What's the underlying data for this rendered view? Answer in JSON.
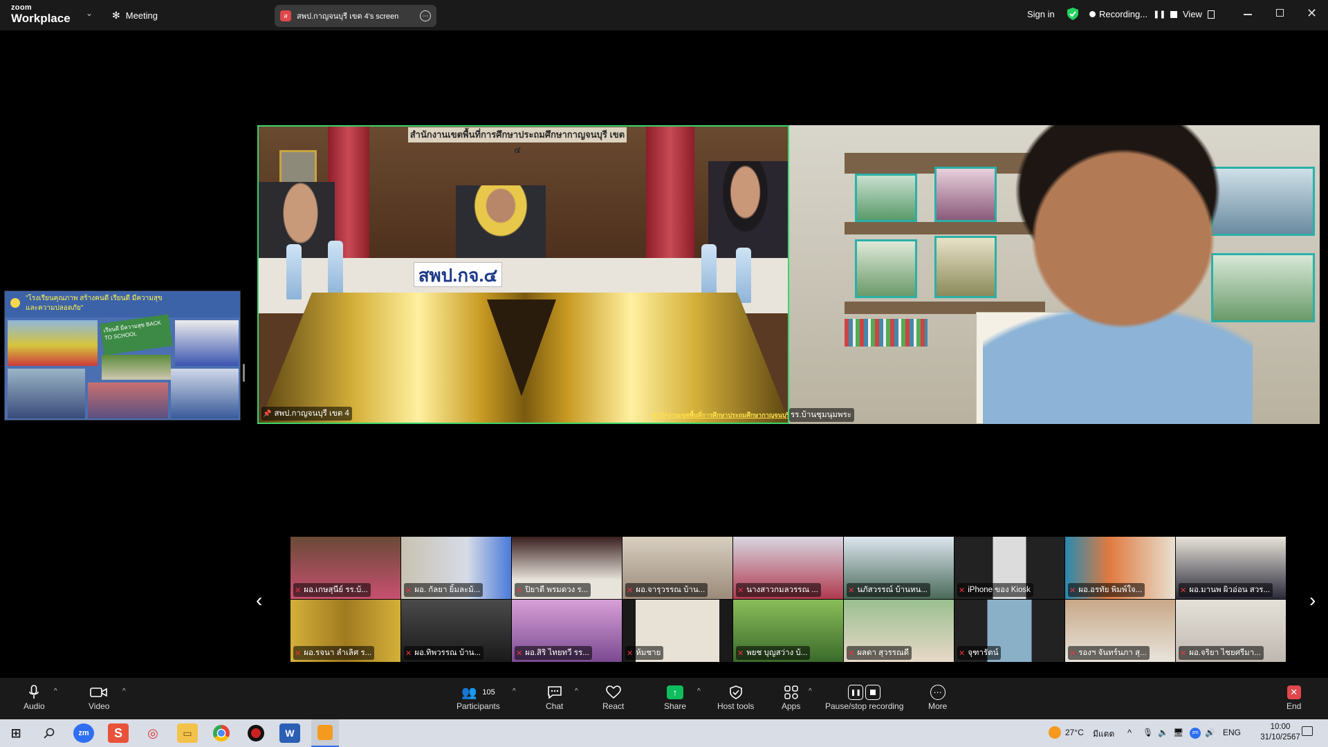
{
  "app": {
    "brand_small": "zoom",
    "brand_large": "Workplace",
    "menu_chevron": "⌄"
  },
  "topbar": {
    "meeting_label": "Meeting",
    "share_tab_label": "สพป.กาญจนบุรี เขต 4's screen",
    "sign_in": "Sign in",
    "recording_label": "Recording...",
    "view_label": "View"
  },
  "main_video": {
    "banner_text": "สำนักงานเขตพื้นที่การศึกษาประถมศึกษากาญจนบุรี เขต ๔",
    "placard": "สพป.กจ.๔",
    "name": "สพป.กาญจนบุรี เขต 4",
    "watermark": "สำนักงานเขตพื้นที่การศึกษาประถมศึกษากาญจนบุรี เขต 4"
  },
  "right_video": {
    "name": "รร.บ้านชุมนุมพระ"
  },
  "left_thumb": {
    "title_line1": "\"โรงเรียนคุณภาพ สร้างคนดี เรียนดี มีความสุข",
    "title_line2": "และความปลอดภัย\"",
    "badge": "เรียนดี มีความสุข BACK TO SCHOOL"
  },
  "gallery": {
    "row1": [
      "ผอ.เกษสุนีย์ รร.บ้...",
      "ผอ. กัลยา ยิ้มละม้...",
      "ปิยาตี พรมดวง ร...",
      "ผอ.จารุวรรณ บ้าน...",
      "นางสาวกมลวรรณ ...",
      "นภัสวรรณ์ บ้านหน...",
      "iPhone ของ Kiosk",
      "ผอ.อรทัย พิมพ์ใจ...",
      "ผอ.มานพ ผิวอ่อน สวร..."
    ],
    "row2": [
      "ผอ.รจนา ลำเลิศ ร...",
      "ผอ.ทิพวรรณ บ้าน...",
      "ผอ.สิริ ไทยทวี รร...",
      "ห้มชาย",
      "พยช บุญสว่าง บ้...",
      "ผลดา สุวรรณดี",
      "จุฑารัตน์",
      "รองฯ จันทร์นภา สุ...",
      "ผอ.จริยา ไชยศรีมา..."
    ],
    "left_arrow": "‹",
    "right_arrow": "›"
  },
  "toolbar": {
    "audio": "Audio",
    "video": "Video",
    "participants": "Participants",
    "participants_count": "105",
    "chat": "Chat",
    "react": "React",
    "share": "Share",
    "host_tools": "Host tools",
    "apps": "Apps",
    "pause_stop": "Pause/stop recording",
    "more": "More",
    "end": "End"
  },
  "taskbar": {
    "temp": "27°C",
    "weather": "มีแดด",
    "lang": "ENG",
    "time": "10:00",
    "date": "31/10/2567"
  },
  "colors": {
    "accent_green": "#23d160",
    "share_green": "#0dbd5e",
    "end_red": "#e0474c",
    "active_border": "#3ad56b"
  }
}
